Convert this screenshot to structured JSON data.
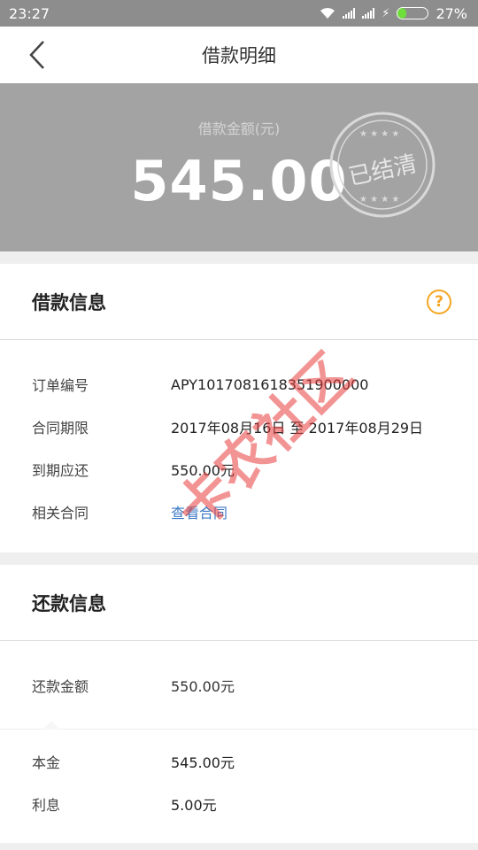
{
  "status_bar": {
    "time": "23:27",
    "battery": "27%",
    "battery_level": 0.27
  },
  "nav": {
    "title": "借款明细"
  },
  "hero": {
    "label": "借款金额(元)",
    "amount": "545.00",
    "stamp": "已结清"
  },
  "loan_info": {
    "title": "借款信息",
    "rows": [
      {
        "label": "订单编号",
        "value": "APY1017081618351900000"
      },
      {
        "label": "合同期限",
        "value": "2017年08月16日 至 2017年08月29日"
      },
      {
        "label": "到期应还",
        "value": "550.00元"
      },
      {
        "label": "相关合同",
        "value": "查看合同"
      }
    ]
  },
  "repay_info": {
    "title": "还款信息",
    "total": {
      "label": "还款金额",
      "value": "550.00元"
    },
    "rows": [
      {
        "label": "本金",
        "value": "545.00元"
      },
      {
        "label": "利息",
        "value": "5.00元"
      }
    ]
  },
  "watermark": {
    "text": "卡农社区"
  },
  "colors": {
    "accent": "#f5a623",
    "link": "#3b78c4",
    "hero_bg": "#a3a3a3",
    "watermark": "#e93c3c"
  }
}
